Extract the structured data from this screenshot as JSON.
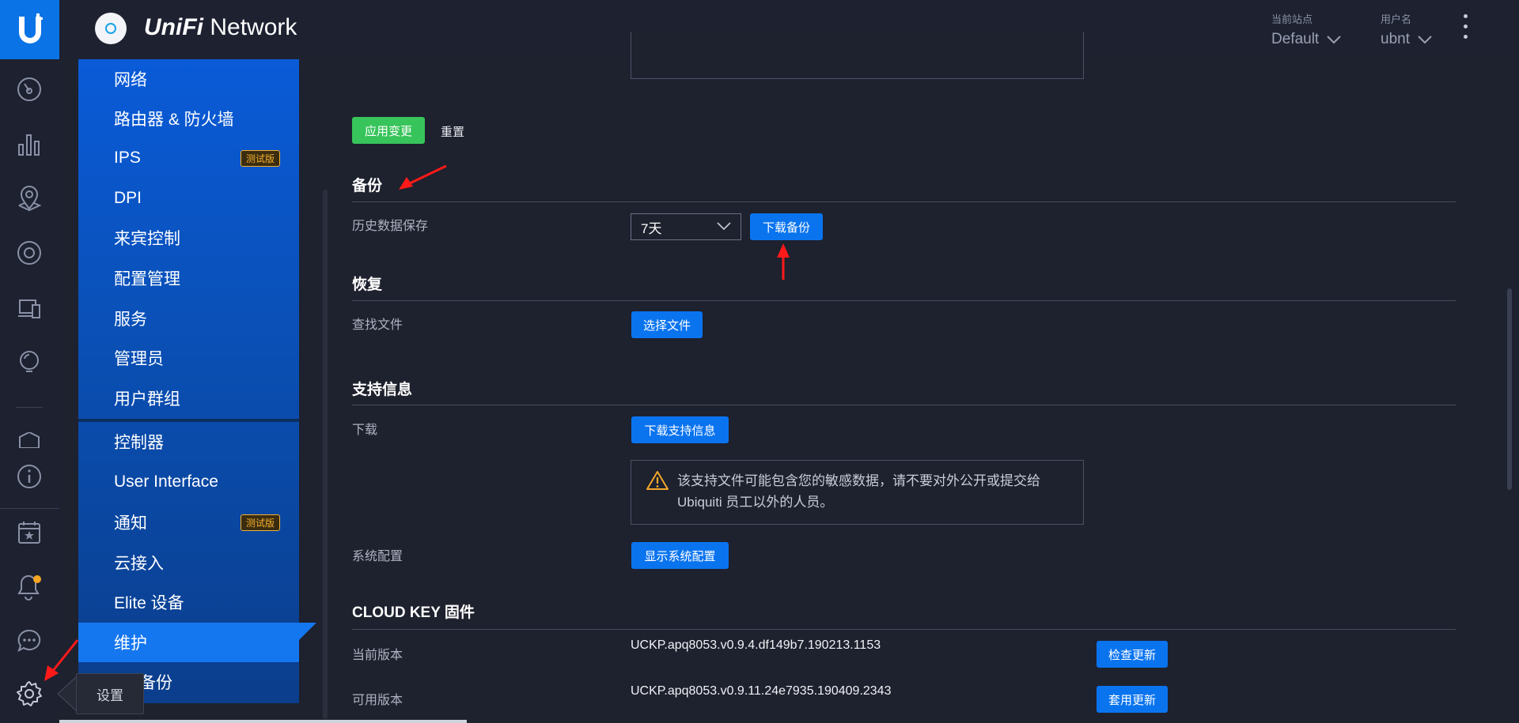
{
  "header": {
    "brand_prefix": "UniFi",
    "brand_suffix": "Network",
    "site_label": "当前站点",
    "site_value": "Default",
    "user_label": "用户名",
    "user_value": "ubnt"
  },
  "rail": {
    "icons": [
      "dashboard-icon",
      "statistics-icon",
      "map-icon",
      "devices-icon",
      "clients-icon",
      "insights-icon",
      "info-icon",
      "events-icon",
      "alerts-icon",
      "chat-icon",
      "settings-icon"
    ],
    "alert_dot_color": "#f6a623"
  },
  "nav": {
    "items": [
      {
        "label": "网络"
      },
      {
        "label": "路由器 & 防火墙"
      },
      {
        "label": "IPS",
        "badge": "测试版"
      },
      {
        "label": "DPI"
      },
      {
        "label": "来宾控制"
      },
      {
        "label": "配置管理"
      },
      {
        "label": "服务"
      },
      {
        "label": "管理员"
      },
      {
        "label": "用户群组"
      },
      {
        "label": "控制器"
      },
      {
        "label": "User Interface"
      },
      {
        "label": "通知",
        "badge": "测试版"
      },
      {
        "label": "云接入"
      },
      {
        "label": "Elite 设备"
      },
      {
        "label": "维护",
        "active": true
      },
      {
        "label": "备份"
      }
    ],
    "tooltip": "设置"
  },
  "main": {
    "apply_button": "应用变更",
    "reset_button": "重置",
    "backup": {
      "title": "备份",
      "history_label": "历史数据保存",
      "history_value": "7天",
      "download_button": "下载备份"
    },
    "restore": {
      "title": "恢复",
      "find_file_label": "查找文件",
      "choose_file_button": "选择文件"
    },
    "support": {
      "title": "支持信息",
      "download_label": "下载",
      "download_button": "下载支持信息",
      "warning": "该支持文件可能包含您的敏感数据，请不要对外公开或提交给 Ubiquiti 员工以外的人员。",
      "sysconfig_label": "系统配置",
      "sysconfig_button": "显示系统配置"
    },
    "firmware": {
      "title": "CLOUD KEY 固件",
      "current_label": "当前版本",
      "current_value": "UCKP.apq8053.v0.9.4.df149b7.190213.1153",
      "check_button": "检查更新",
      "available_label": "可用版本",
      "available_value": "UCKP.apq8053.v0.9.11.24e7935.190409.2343",
      "apply_button": "套用更新"
    }
  },
  "colors": {
    "accent": "#0a74ef",
    "apply": "#37c45a",
    "annotation": "#ff1a1a"
  }
}
